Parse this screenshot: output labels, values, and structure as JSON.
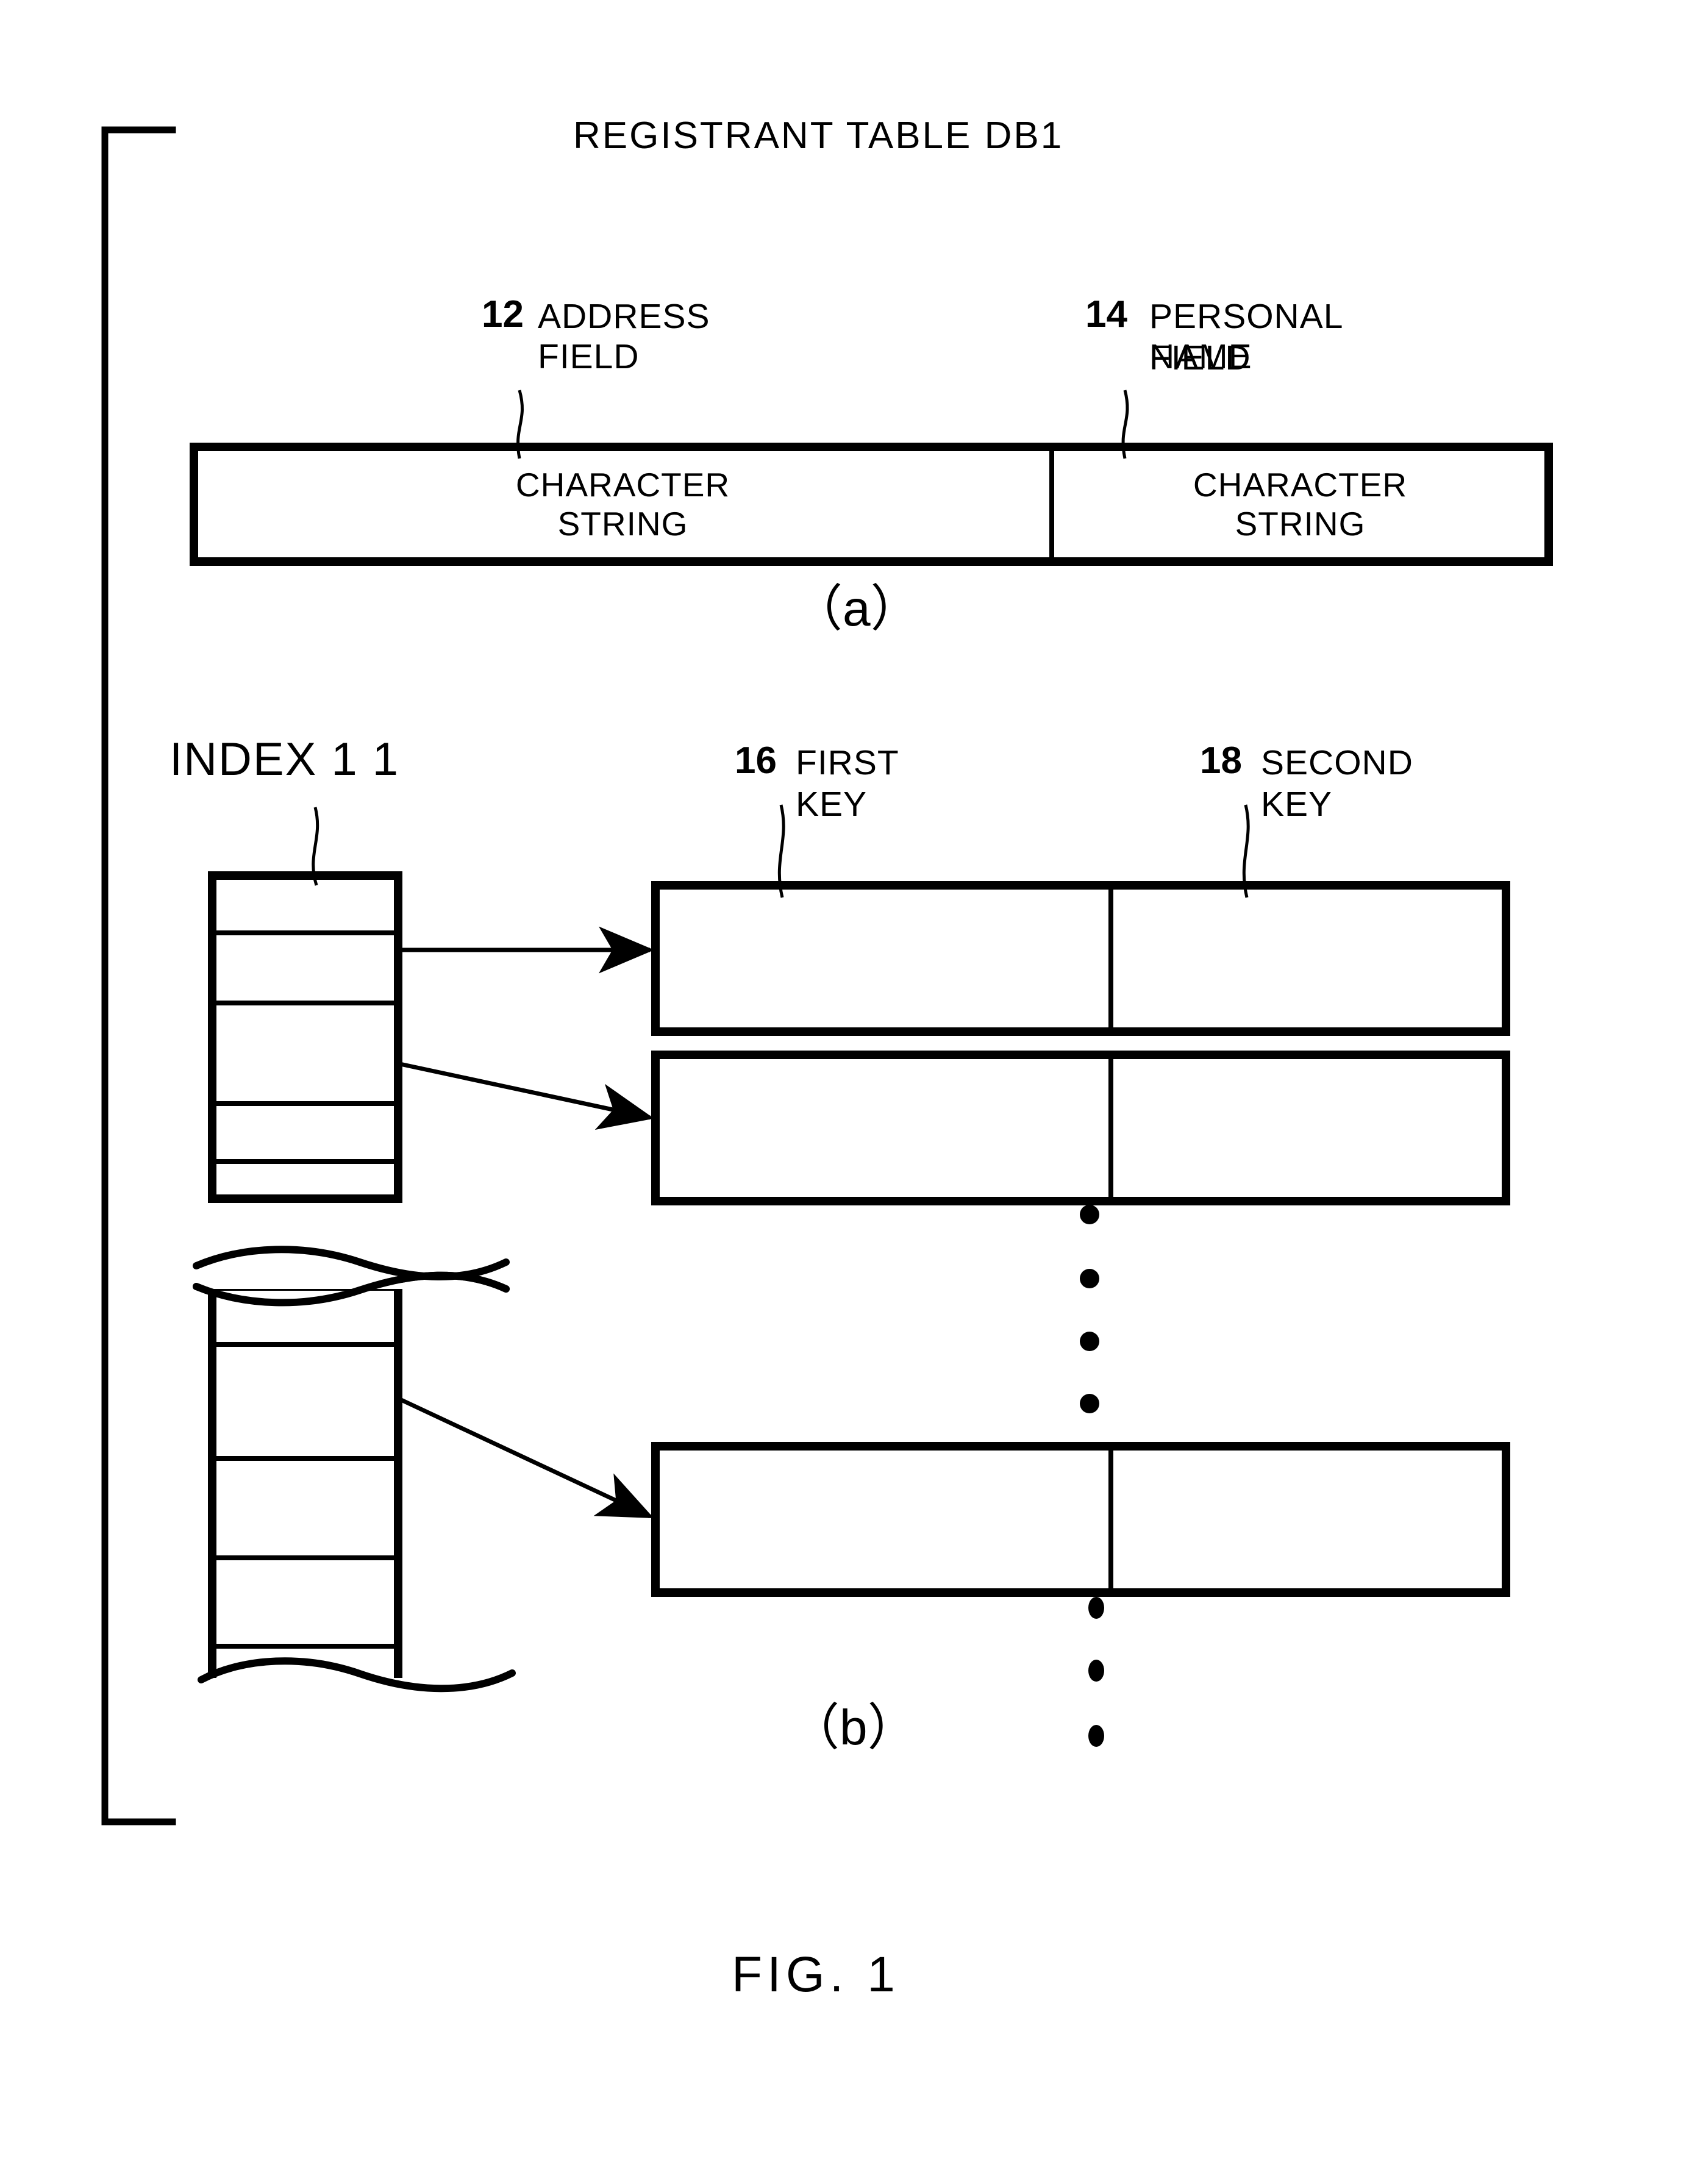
{
  "figure": {
    "caption": "FIG. 1",
    "title": "REGISTRANT TABLE DB1",
    "subfigure_a_label": "（a）",
    "subfigure_b_label": "（b）"
  },
  "part_a": {
    "title": "REGISTRANT TABLE DB1",
    "callouts": [
      {
        "number": "12",
        "label": "ADDRESS FIELD"
      },
      {
        "number": "14",
        "label_line1": "PERSONAL NAME",
        "label_line2": "FIELD"
      }
    ],
    "table": {
      "cells": [
        {
          "line1": "CHARACTER",
          "line2": "STRING"
        },
        {
          "line1": "CHARACTER",
          "line2": "STRING"
        }
      ]
    },
    "label": "（a）"
  },
  "part_b": {
    "index_label": "INDEX 1 1",
    "callouts": [
      {
        "number": "16",
        "label_line1": "FIRST",
        "label_line2": "KEY"
      },
      {
        "number": "18",
        "label_line1": "SECOND",
        "label_line2": "KEY"
      }
    ],
    "index_column": {
      "segments": [
        "upper",
        "lower"
      ],
      "upper_rows": 4,
      "lower_rows": 5,
      "break_style": "wavy"
    },
    "records": [
      {
        "first_key": "",
        "second_key": ""
      },
      {
        "first_key": "",
        "second_key": ""
      },
      {
        "first_key": "",
        "second_key": ""
      }
    ],
    "ellipsis_middle_dots": 4,
    "ellipsis_bottom_dots": 3,
    "label": "（b）"
  },
  "colors": {
    "ink": "#000000",
    "paper": "#ffffff"
  }
}
